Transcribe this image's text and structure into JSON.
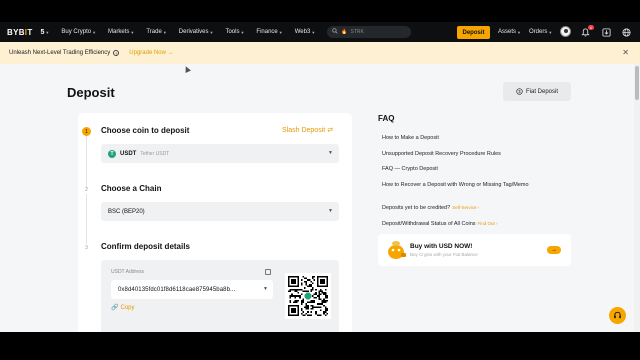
{
  "nav": {
    "logo_main": "BYB",
    "logo_accent": "I",
    "logo_end": "T",
    "badge": "5",
    "items": [
      {
        "label": "Buy Crypto"
      },
      {
        "label": "Markets"
      },
      {
        "label": "Trade"
      },
      {
        "label": "Derivatives"
      },
      {
        "label": "Tools"
      },
      {
        "label": "Finance"
      },
      {
        "label": "Web3"
      }
    ],
    "search_placeholder": "STRK",
    "deposit": "Deposit",
    "assets": "Assets",
    "orders": "Orders",
    "notification_count": "8",
    "brand_color": "#f7a600"
  },
  "banner": {
    "text": "Unleash Next-Level Trading Efficiency",
    "upgrade": "Upgrade Now",
    "upgrade_arrow": "→",
    "close": "✕"
  },
  "page": {
    "title": "Deposit",
    "fiat_button": "Fiat Deposit"
  },
  "steps": [
    {
      "num": "1",
      "title": "Choose coin to deposit"
    },
    {
      "num": "2",
      "title": "Choose a Chain"
    },
    {
      "num": "3",
      "title": "Confirm deposit details"
    }
  ],
  "coin": {
    "symbol": "USDT",
    "name": "Tether USDT",
    "icon_letter": "T",
    "slash_deposit": "Slash Deposit"
  },
  "chain": {
    "value": "BSC (BEP20)"
  },
  "details": {
    "address_label": "USDT Address",
    "address": "0x8d40135fdc01f8d6118cae875945ba8b...",
    "copy": "Copy"
  },
  "faq": {
    "title": "FAQ",
    "items": [
      {
        "text": "How to Make a Deposit"
      },
      {
        "text": "Unsupported Deposit Recovery Procedure Rules"
      },
      {
        "text": "FAQ — Crypto Deposit"
      },
      {
        "text": "How to Recover a Deposit with Wrong or Missing Tag/Memo"
      }
    ],
    "extra": [
      {
        "text": "Deposits yet to be credited?",
        "link": "Self-Service ›"
      },
      {
        "text": "Deposit/Withdrawal Status of All Coins",
        "link": "Find Out ›"
      }
    ]
  },
  "promo": {
    "title": "Buy with USD NOW!",
    "subtitle": "Buy Crypto with your Fiat Balance",
    "arrow": "→"
  }
}
